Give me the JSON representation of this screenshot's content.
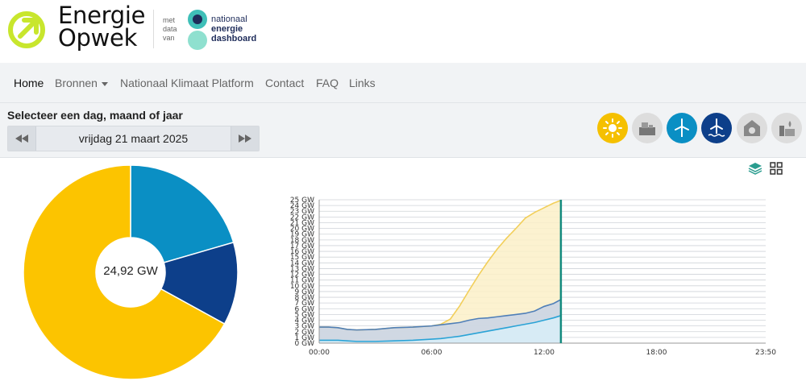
{
  "header": {
    "brand_line1": "Energie",
    "brand_line2": "Opwek",
    "partner_prefix": [
      "met",
      "data",
      "van"
    ],
    "partner_name": [
      "nationaal",
      "energie",
      "dashboard"
    ],
    "brand_color": "#c8e62d"
  },
  "nav": {
    "items": [
      {
        "label": "Home",
        "active": true
      },
      {
        "label": "Bronnen",
        "dropdown": true
      },
      {
        "label": "Nationaal Klimaat Platform"
      },
      {
        "label": "Contact"
      },
      {
        "label": "FAQ"
      },
      {
        "label": "Links"
      }
    ]
  },
  "selector": {
    "title": "Selecteer een dag, maand of jaar",
    "date": "vrijdag 21 maart 2025"
  },
  "sources": [
    {
      "icon": "sun-icon",
      "color": "#f5c000"
    },
    {
      "icon": "power-plant-icon",
      "color": "#dddddd"
    },
    {
      "icon": "wind-turbine-icon",
      "color": "#0a8fc4"
    },
    {
      "icon": "offshore-wind-icon",
      "color": "#0d3f8a"
    },
    {
      "icon": "biomass-icon",
      "color": "#dddddd"
    },
    {
      "icon": "gas-factory-icon",
      "color": "#dddddd"
    }
  ],
  "pie": {
    "total_label": "24,92 GW",
    "slices": [
      {
        "name": "Wind op land",
        "share": 0.205,
        "color": "#0a8fc4"
      },
      {
        "name": "Wind op zee",
        "share": 0.125,
        "color": "#0d3f8a"
      },
      {
        "name": "Zon",
        "share": 0.67,
        "color": "#fcc400"
      }
    ]
  },
  "chart_data": {
    "type": "area",
    "x_ticks": [
      "00:00",
      "06:00",
      "12:00",
      "18:00",
      "23:50"
    ],
    "y_tick_labels": [
      "0 GW",
      "1 GW",
      "2 GW",
      "3 GW",
      "4 GW",
      "5 GW",
      "6 GW",
      "7 GW",
      "8 GW",
      "9 GW",
      "10 GW",
      "11 GW",
      "12 GW",
      "13 GW",
      "14 GW",
      "15 GW",
      "16 GW",
      "17 GW",
      "18 GW",
      "19 GW",
      "20 GW",
      "21 GW",
      "22 GW",
      "23 GW",
      "24 GW",
      "25 GW"
    ],
    "ylim": [
      0,
      25
    ],
    "x_hours": [
      0,
      0.5,
      1,
      1.5,
      2,
      3,
      4,
      5,
      6,
      6.5,
      7,
      7.5,
      8,
      8.5,
      9,
      9.5,
      10,
      10.5,
      11,
      11.5,
      12,
      12.5,
      12.9
    ],
    "now_hour": 12.9,
    "x_max_hour": 23.83,
    "series": [
      {
        "color": "#2aa3d6",
        "fill": "#d8eef8",
        "values": [
          0.5,
          0.5,
          0.5,
          0.4,
          0.3,
          0.3,
          0.4,
          0.5,
          0.7,
          0.8,
          1.0,
          1.2,
          1.5,
          1.8,
          2.1,
          2.4,
          2.7,
          3.0,
          3.3,
          3.6,
          4.0,
          4.4,
          4.8
        ]
      },
      {
        "color": "#4f7fb8",
        "fill": "#c8d4e6",
        "values": [
          2.8,
          2.8,
          2.7,
          2.4,
          2.3,
          2.4,
          2.7,
          2.8,
          3.0,
          3.2,
          3.4,
          3.6,
          4.0,
          4.3,
          4.4,
          4.6,
          4.8,
          5.0,
          5.2,
          5.6,
          6.4,
          6.9,
          7.6
        ]
      },
      {
        "color": "#f2cf5a",
        "fill": "#fbf0c8",
        "values": [
          2.8,
          2.8,
          2.7,
          2.4,
          2.3,
          2.4,
          2.7,
          2.8,
          3.0,
          3.3,
          4.2,
          6.5,
          9.2,
          11.8,
          14.2,
          16.4,
          18.3,
          20.0,
          21.8,
          22.8,
          23.6,
          24.4,
          24.9
        ]
      }
    ]
  }
}
